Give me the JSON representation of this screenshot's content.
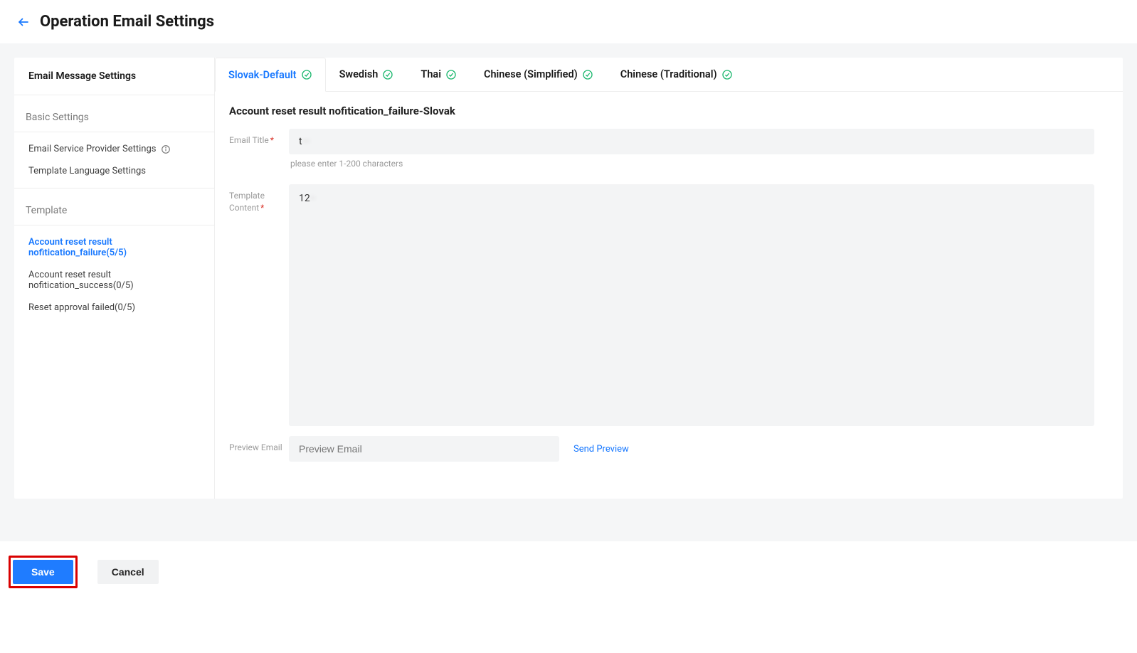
{
  "header": {
    "title": "Operation Email Settings"
  },
  "sidebar": {
    "section_title": "Email Message Settings",
    "group_basic_label": "Basic Settings",
    "basic_items": [
      {
        "label": "Email Service Provider Settings",
        "has_info": true
      },
      {
        "label": "Template Language Settings",
        "has_info": false
      }
    ],
    "group_template_label": "Template",
    "template_items": [
      {
        "label": "Account reset result nofitication_failure(5/5)",
        "active": true
      },
      {
        "label": "Account reset result nofitication_success(0/5)",
        "active": false
      },
      {
        "label": "Reset approval failed(0/5)",
        "active": false
      }
    ]
  },
  "tabs": [
    {
      "label": "Slovak-Default",
      "active": true
    },
    {
      "label": "Swedish",
      "active": false
    },
    {
      "label": "Thai",
      "active": false
    },
    {
      "label": "Chinese (Simplified)",
      "active": false
    },
    {
      "label": "Chinese (Traditional)",
      "active": false
    }
  ],
  "main": {
    "section_title": "Account reset result nofitication_failure-Slovak",
    "email_title_label": "Email Title",
    "email_title_value_visible": "t",
    "email_title_value_blurred": "···",
    "email_title_hint": "please enter 1-200 characters",
    "template_content_label": "Template Content",
    "template_content_value_visible": "12",
    "template_content_value_blurred": "··",
    "preview_label": "Preview Email",
    "preview_placeholder": "Preview Email",
    "send_preview": "Send Preview"
  },
  "footer": {
    "save": "Save",
    "cancel": "Cancel"
  }
}
